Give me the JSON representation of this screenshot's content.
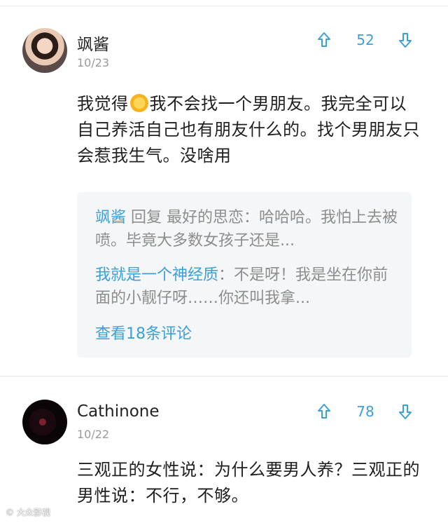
{
  "comments": [
    {
      "username": "飒酱",
      "date": "10/23",
      "votes": "52",
      "body_before_emoji": "我觉得",
      "emoji": "sun-emoji",
      "body_after_emoji": "我不会找一个男朋友。我完全可以自己养活自己也有朋友什么的。找个男朋友只会惹我生气。没啥用",
      "replies": [
        {
          "name": "飒酱",
          "text": " 回复 最好的思恋：哈哈哈。我怕上去被喷。毕竟大多数女孩子还是..."
        },
        {
          "name": "我就是一个神经质",
          "text": "：不是呀！我是坐在你前面的小靓仔呀……你还叫我拿..."
        }
      ],
      "more_link": "查看18条评论"
    },
    {
      "username": "Cathinone",
      "date": "10/22",
      "votes": "78",
      "body": "三观正的女性说：为什么要男人养？三观正的男性说：不行，不够。"
    }
  ],
  "icons": {
    "upvote": "arrow-up-icon",
    "downvote": "arrow-down-icon"
  },
  "watermark": "© 大众影视",
  "colors": {
    "accent": "#3b9fd8",
    "reply_bg": "#f5f6f7",
    "muted": "#9a9a9a"
  }
}
